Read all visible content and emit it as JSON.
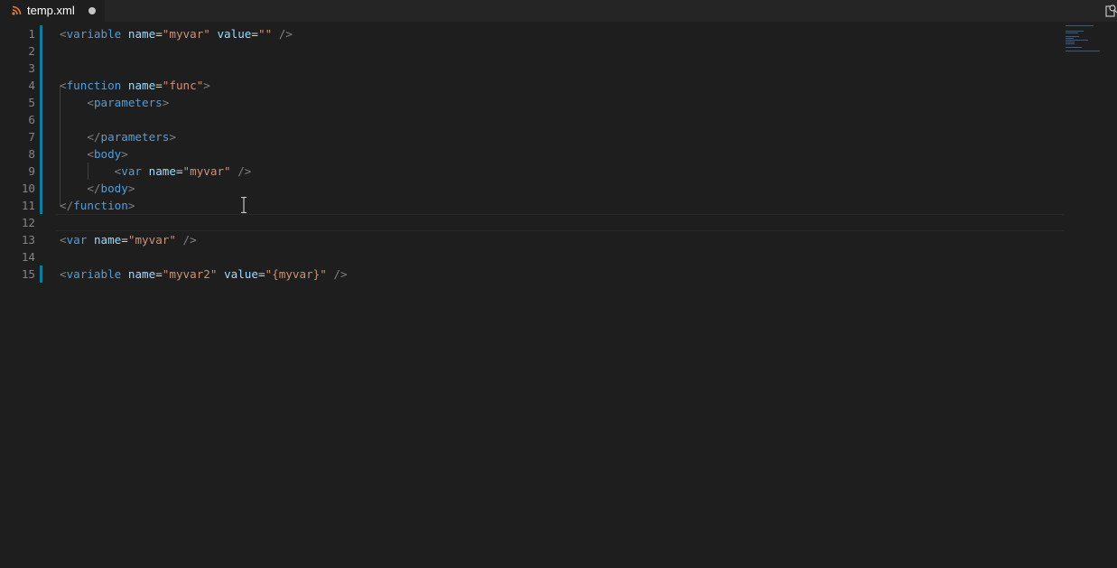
{
  "tab": {
    "label": "temp.xml",
    "icon": "rss-icon",
    "dirty": true
  },
  "editor": {
    "lines": [
      {
        "n": "1",
        "tokens": [
          [
            "punct",
            "<"
          ],
          [
            "tag",
            "variable"
          ],
          [
            "sp",
            " "
          ],
          [
            "attr",
            "name"
          ],
          [
            "eq",
            "="
          ],
          [
            "str",
            "\"myvar\""
          ],
          [
            "sp",
            " "
          ],
          [
            "attr",
            "value"
          ],
          [
            "eq",
            "="
          ],
          [
            "str",
            "\"\""
          ],
          [
            "sp",
            " "
          ],
          [
            "punct",
            "/>"
          ]
        ]
      },
      {
        "n": "2",
        "tokens": []
      },
      {
        "n": "3",
        "tokens": []
      },
      {
        "n": "4",
        "tokens": [
          [
            "punct",
            "<"
          ],
          [
            "tag",
            "function"
          ],
          [
            "sp",
            " "
          ],
          [
            "attr",
            "name"
          ],
          [
            "eq",
            "="
          ],
          [
            "str",
            "\"func\""
          ],
          [
            "punct",
            ">"
          ]
        ]
      },
      {
        "n": "5",
        "tokens": [
          [
            "sp",
            "    "
          ],
          [
            "punct",
            "<"
          ],
          [
            "tag",
            "parameters"
          ],
          [
            "punct",
            ">"
          ]
        ]
      },
      {
        "n": "6",
        "tokens": []
      },
      {
        "n": "7",
        "tokens": [
          [
            "sp",
            "    "
          ],
          [
            "punct",
            "</"
          ],
          [
            "tag",
            "parameters"
          ],
          [
            "punct",
            ">"
          ]
        ]
      },
      {
        "n": "8",
        "tokens": [
          [
            "sp",
            "    "
          ],
          [
            "punct",
            "<"
          ],
          [
            "tag",
            "body"
          ],
          [
            "punct",
            ">"
          ]
        ]
      },
      {
        "n": "9",
        "tokens": [
          [
            "sp",
            "        "
          ],
          [
            "punct",
            "<"
          ],
          [
            "tag",
            "var"
          ],
          [
            "sp",
            " "
          ],
          [
            "attr",
            "name"
          ],
          [
            "eq",
            "="
          ],
          [
            "str",
            "\"myvar\""
          ],
          [
            "sp",
            " "
          ],
          [
            "punct",
            "/>"
          ]
        ]
      },
      {
        "n": "10",
        "tokens": [
          [
            "sp",
            "    "
          ],
          [
            "punct",
            "</"
          ],
          [
            "tag",
            "body"
          ],
          [
            "punct",
            ">"
          ]
        ]
      },
      {
        "n": "11",
        "tokens": [
          [
            "punct",
            "</"
          ],
          [
            "tag",
            "function"
          ],
          [
            "punct",
            ">"
          ]
        ]
      },
      {
        "n": "12",
        "tokens": []
      },
      {
        "n": "13",
        "tokens": [
          [
            "punct",
            "<"
          ],
          [
            "tag",
            "var"
          ],
          [
            "sp",
            " "
          ],
          [
            "attr",
            "name"
          ],
          [
            "eq",
            "="
          ],
          [
            "str",
            "\"myvar\""
          ],
          [
            "sp",
            " "
          ],
          [
            "punct",
            "/>"
          ]
        ]
      },
      {
        "n": "14",
        "tokens": []
      },
      {
        "n": "15",
        "tokens": [
          [
            "punct",
            "<"
          ],
          [
            "tag",
            "variable"
          ],
          [
            "sp",
            " "
          ],
          [
            "attr",
            "name"
          ],
          [
            "eq",
            "="
          ],
          [
            "str",
            "\"myvar2\""
          ],
          [
            "sp",
            " "
          ],
          [
            "attr",
            "value"
          ],
          [
            "eq",
            "="
          ],
          [
            "str",
            "\"{myvar}\""
          ],
          [
            "sp",
            " "
          ],
          [
            "punct",
            "/>"
          ]
        ]
      }
    ],
    "modified_lines": [
      "1",
      "2",
      "3",
      "4",
      "5",
      "6",
      "7",
      "8",
      "9",
      "10",
      "11",
      "15"
    ]
  },
  "colors": {
    "background": "#1e1e1e",
    "tab_bar": "#252526",
    "line_number": "#858585",
    "gutter_modified": "#0c7d9d",
    "tag": "#569cd6",
    "attribute": "#9cdcfe",
    "string": "#ce9178",
    "punctuation": "#808080"
  }
}
